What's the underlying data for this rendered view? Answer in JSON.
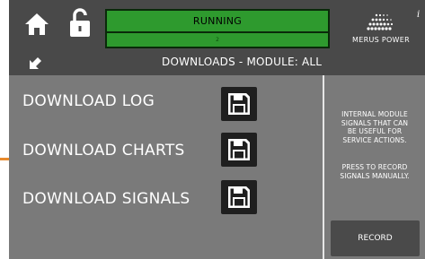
{
  "status": {
    "state": "RUNNING",
    "detail": "2",
    "color": "#2e9a2e"
  },
  "logo": {
    "text": "MERUS POWER",
    "info": "i"
  },
  "header": {
    "title": "DOWNLOADS - MODULE: ALL"
  },
  "downloads": [
    {
      "label": "DOWNLOAD LOG",
      "icon": "floppy-disk-icon"
    },
    {
      "label": "DOWNLOAD CHARTS",
      "icon": "floppy-disk-icon"
    },
    {
      "label": "DOWNLOAD SIGNALS",
      "icon": "floppy-disk-icon"
    }
  ],
  "side": {
    "description": [
      "INTERNAL MODULE",
      "SIGNALS THAT CAN",
      "BE USEFUL FOR",
      "SERVICE ACTIONS."
    ],
    "instruction": [
      "PRESS TO RECORD",
      "SIGNALS MANUALLY."
    ],
    "record_label": "RECORD"
  },
  "icons": {
    "home": "home-icon",
    "lock": "unlock-icon",
    "back": "arrow-down-left-icon"
  },
  "colors": {
    "accent": "#e88a2c",
    "panel": "#7a7a7a",
    "bar": "#494949"
  }
}
